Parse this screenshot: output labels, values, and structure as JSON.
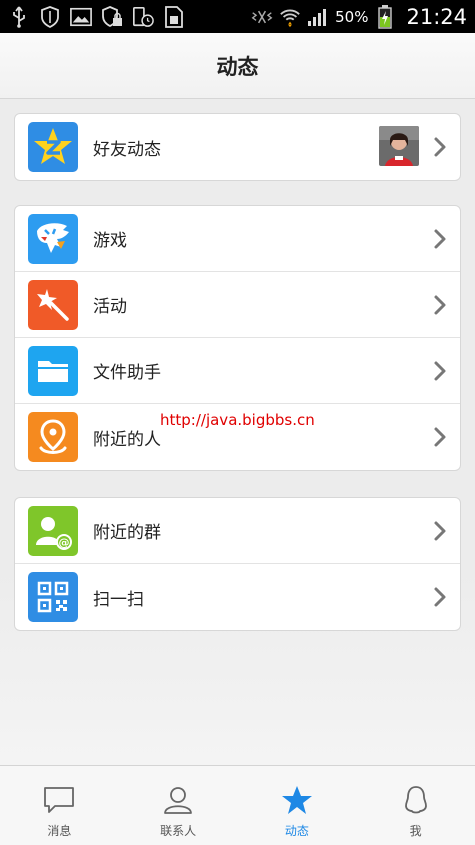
{
  "status_bar": {
    "battery": "50%",
    "time": "21:24"
  },
  "header": {
    "title": "动态"
  },
  "sections": [
    {
      "items": [
        {
          "label": "好友动态",
          "icon": "star-z-icon",
          "color": "#2f8de4"
        }
      ]
    },
    {
      "items": [
        {
          "label": "游戏",
          "icon": "game-icon",
          "color": "#2d9cf0"
        },
        {
          "label": "活动",
          "icon": "magic-wand-icon",
          "color": "#f05a28"
        },
        {
          "label": "文件助手",
          "icon": "folder-icon",
          "color": "#1ea5f0"
        },
        {
          "label": "附近的人",
          "icon": "location-pin-icon",
          "color": "#f58a1f"
        }
      ]
    },
    {
      "items": [
        {
          "label": "附近的群",
          "icon": "group-at-icon",
          "color": "#7fc62a"
        },
        {
          "label": "扫一扫",
          "icon": "qr-code-icon",
          "color": "#2f8de4"
        }
      ]
    }
  ],
  "watermark": "http://java.bigbbs.cn",
  "tabs": [
    {
      "label": "消息",
      "icon": "chat-bubble-icon",
      "active": false
    },
    {
      "label": "联系人",
      "icon": "person-icon",
      "active": false
    },
    {
      "label": "动态",
      "icon": "star-icon",
      "active": true
    },
    {
      "label": "我",
      "icon": "penguin-icon",
      "active": false
    }
  ],
  "colors": {
    "accent": "#1e88e5",
    "background": "#ececec"
  }
}
